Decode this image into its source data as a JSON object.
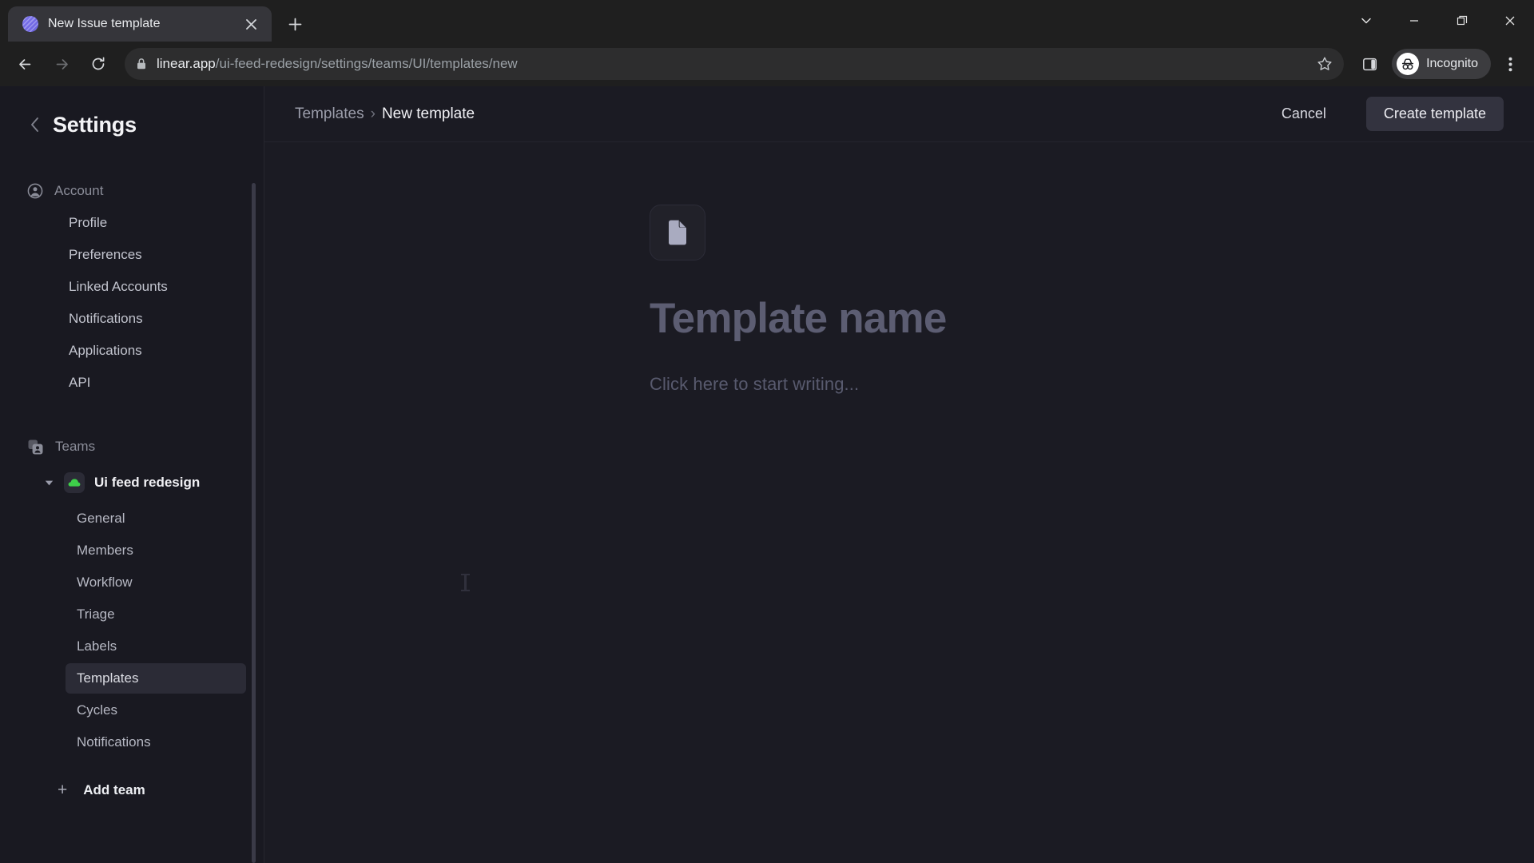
{
  "browser": {
    "tab": {
      "title": "New Issue template",
      "favicon_icon": "linear-logo-icon",
      "close_icon": "close-icon"
    },
    "new_tab_icon": "plus-icon",
    "window_controls": {
      "tab_search_icon": "chevron-down-icon",
      "minimize_icon": "minimize-icon",
      "maximize_icon": "restore-icon",
      "close_icon": "close-icon"
    },
    "toolbar": {
      "back_icon": "arrow-left-icon",
      "forward_icon": "arrow-right-icon",
      "reload_icon": "reload-icon",
      "lock_icon": "lock-icon",
      "url_host": "linear.app",
      "url_path": "/ui-feed-redesign/settings/teams/UI/templates/new",
      "url_full": "linear.app/ui-feed-redesign/settings/teams/UI/templates/new",
      "bookmark_icon": "star-icon",
      "side_panel_icon": "side-panel-icon",
      "incognito_label": "Incognito",
      "incognito_icon": "incognito-icon",
      "menu_icon": "kebab-menu-icon"
    }
  },
  "sidebar": {
    "back_icon": "chevron-left-icon",
    "title": "Settings",
    "account": {
      "icon": "account-circle-icon",
      "label": "Account",
      "items": [
        {
          "label": "Profile"
        },
        {
          "label": "Preferences"
        },
        {
          "label": "Linked Accounts"
        },
        {
          "label": "Notifications"
        },
        {
          "label": "Applications"
        },
        {
          "label": "API"
        }
      ]
    },
    "teams": {
      "icon": "teams-icon",
      "label": "Teams",
      "team": {
        "caret_icon": "caret-down-icon",
        "avatar_icon": "green-cloud-icon",
        "name": "Ui feed redesign",
        "items": [
          {
            "label": "General",
            "active": false
          },
          {
            "label": "Members",
            "active": false
          },
          {
            "label": "Workflow",
            "active": false
          },
          {
            "label": "Triage",
            "active": false
          },
          {
            "label": "Labels",
            "active": false
          },
          {
            "label": "Templates",
            "active": true
          },
          {
            "label": "Cycles",
            "active": false
          },
          {
            "label": "Notifications",
            "active": false
          }
        ]
      }
    },
    "add_team": {
      "plus": "+",
      "label": "Add team"
    }
  },
  "main": {
    "breadcrumb": {
      "parent": "Templates",
      "separator": "›",
      "current": "New template"
    },
    "cancel_label": "Cancel",
    "create_label": "Create template",
    "editor": {
      "doc_icon": "document-page-icon",
      "title_placeholder": "Template name",
      "body_placeholder": "Click here to start writing..."
    }
  },
  "colors": {
    "app_bg": "#1b1b23",
    "sidebar_bg": "#191921",
    "chrome_bg": "#1f1f1f",
    "active_item_bg": "#2b2b36",
    "primary_button_bg": "#33333f",
    "team_accent": "#3ecf4a",
    "favicon_accent": "#6b62e0"
  }
}
